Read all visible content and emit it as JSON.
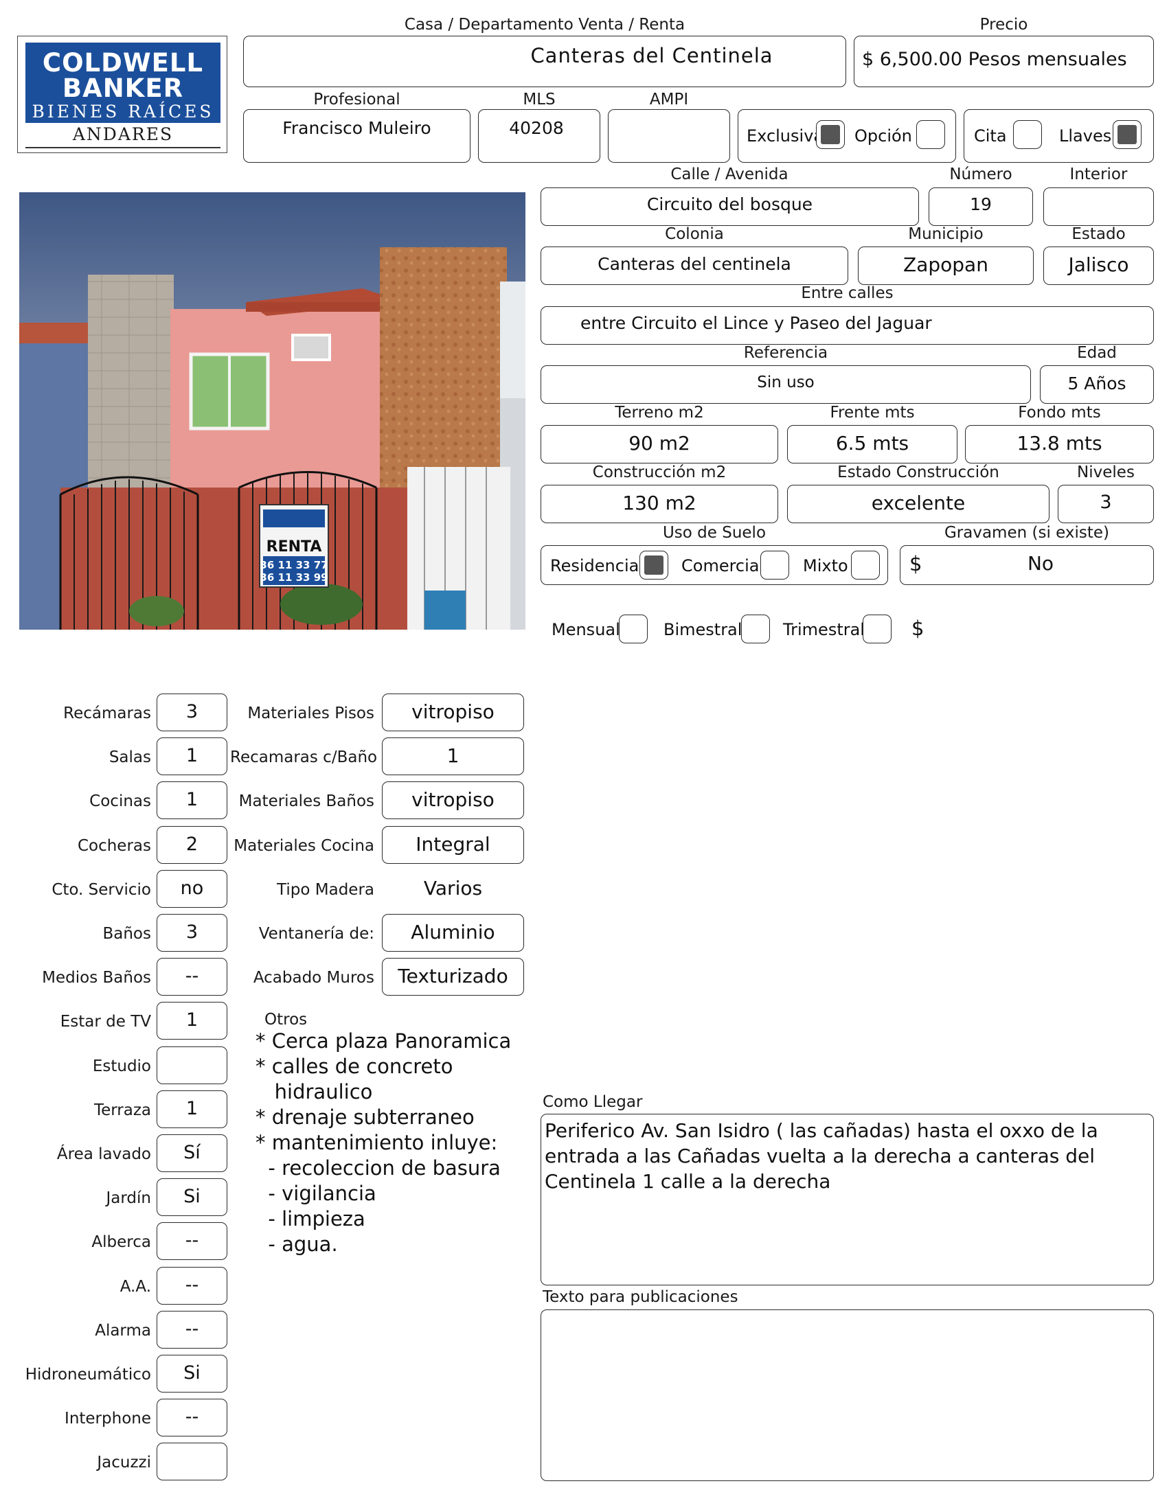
{
  "header": {
    "tipo_label": "Casa / Departamento   Venta / Renta",
    "titulo": "Canteras del Centinela",
    "precio_label": "Precio",
    "precio": "$ 6,500.00 Pesos mensuales",
    "profesional_label": "Profesional",
    "profesional": "Francisco Muleiro",
    "mls_label": "MLS",
    "mls": "40208",
    "ampi_label": "AMPI",
    "ampi": "",
    "exclusiva_label": "Exclusiva",
    "exclusiva_checked": true,
    "opcion_label": "Opción",
    "opcion_checked": false,
    "cita_label": "Cita",
    "cita_checked": false,
    "llaves_label": "Llaves",
    "llaves_checked": true
  },
  "logo": {
    "line1": "COLDWELL",
    "line2": "BANKER",
    "line3": "BIENES RAÍCES",
    "line4": "ANDARES",
    "brand_color": "#1b4f9b"
  },
  "photo": {
    "sign_title": "RENTA",
    "sign_phone1": "36 11 33 77",
    "sign_phone2": "36 11 33 99"
  },
  "direccion": {
    "calle_label": "Calle / Avenida",
    "calle": "Circuito del bosque",
    "numero_label": "Número",
    "numero": "19",
    "interior_label": "Interior",
    "interior": "",
    "colonia_label": "Colonia",
    "colonia": "Canteras del centinela",
    "municipio_label": "Municipio",
    "municipio": "Zapopan",
    "estado_label": "Estado",
    "estado": "Jalisco",
    "entre_label": "Entre calles",
    "entre": "entre Circuito el Lince y Paseo del Jaguar",
    "referencia_label": "Referencia",
    "referencia": "Sin uso",
    "edad_label": "Edad",
    "edad": "5 Años"
  },
  "medidas": {
    "terreno_label": "Terreno m2",
    "terreno": "90 m2",
    "frente_label": "Frente mts",
    "frente": "6.5 mts",
    "fondo_label": "Fondo mts",
    "fondo": "13.8 mts",
    "construccion_label": "Construcción m2",
    "construccion": "130 m2",
    "estado_const_label": "Estado Construcción",
    "estado_const": "excelente",
    "niveles_label": "Niveles",
    "niveles": "3"
  },
  "uso_suelo": {
    "label": "Uso de Suelo",
    "residencial_label": "Residencial",
    "residencial_checked": true,
    "comercial_label": "Comercial",
    "comercial_checked": false,
    "mixto_label": "Mixto",
    "mixto_checked": false,
    "gravamen_label": "Gravamen (si existe)",
    "gravamen_symbol": "$",
    "gravamen": "No"
  },
  "mantenimiento": {
    "mensual_label": "Mensual",
    "bimestral_label": "Bimestral",
    "trimestral_label": "Trimestral",
    "symbol": "$"
  },
  "caracteristicas": [
    {
      "label": "Recámaras",
      "value": "3"
    },
    {
      "label": "Salas",
      "value": "1"
    },
    {
      "label": "Cocinas",
      "value": "1"
    },
    {
      "label": "Cocheras",
      "value": "2"
    },
    {
      "label": "Cto. Servicio",
      "value": "no"
    },
    {
      "label": "Baños",
      "value": "3"
    },
    {
      "label": "Medios Baños",
      "value": "--"
    },
    {
      "label": "Estar de TV",
      "value": "1"
    },
    {
      "label": "Estudio",
      "value": ""
    },
    {
      "label": "Terraza",
      "value": "1"
    },
    {
      "label": "Área lavado",
      "value": "Sí"
    },
    {
      "label": "Jardín",
      "value": "Si"
    },
    {
      "label": "Alberca",
      "value": "--"
    },
    {
      "label": "A.A.",
      "value": "--"
    },
    {
      "label": "Alarma",
      "value": "--"
    },
    {
      "label": "Hidroneumático",
      "value": "Si"
    },
    {
      "label": "Interphone",
      "value": "--"
    },
    {
      "label": "Jacuzzi",
      "value": ""
    }
  ],
  "materiales": [
    {
      "label": "Materiales Pisos",
      "value": "vitropiso"
    },
    {
      "label": "Recamaras c/Baño",
      "value": "1"
    },
    {
      "label": "Materiales Baños",
      "value": "vitropiso"
    },
    {
      "label": "Materiales Cocina",
      "value": "Integral"
    },
    {
      "label": "Tipo Madera",
      "value": "Varios"
    },
    {
      "label": "Ventanería de:",
      "value": "Aluminio"
    },
    {
      "label": "Acabado Muros",
      "value": "Texturizado"
    }
  ],
  "otros": {
    "label": "Otros",
    "lines": [
      "* Cerca plaza Panoramica",
      "* calles de concreto",
      "   hidraulico",
      "* drenaje subterraneo",
      "* mantenimiento inluye:",
      "  - recoleccion de basura",
      "  - vigilancia",
      "  - limpieza",
      "  - agua."
    ]
  },
  "como_llegar": {
    "label": "Como Llegar",
    "text": "Periferico Av. San Isidro ( las cañadas) hasta el oxxo de la entrada a las Cañadas vuelta a la derecha a canteras del Centinela 1 calle a la derecha"
  },
  "publicaciones": {
    "label": "Texto para publicaciones",
    "text": ""
  }
}
